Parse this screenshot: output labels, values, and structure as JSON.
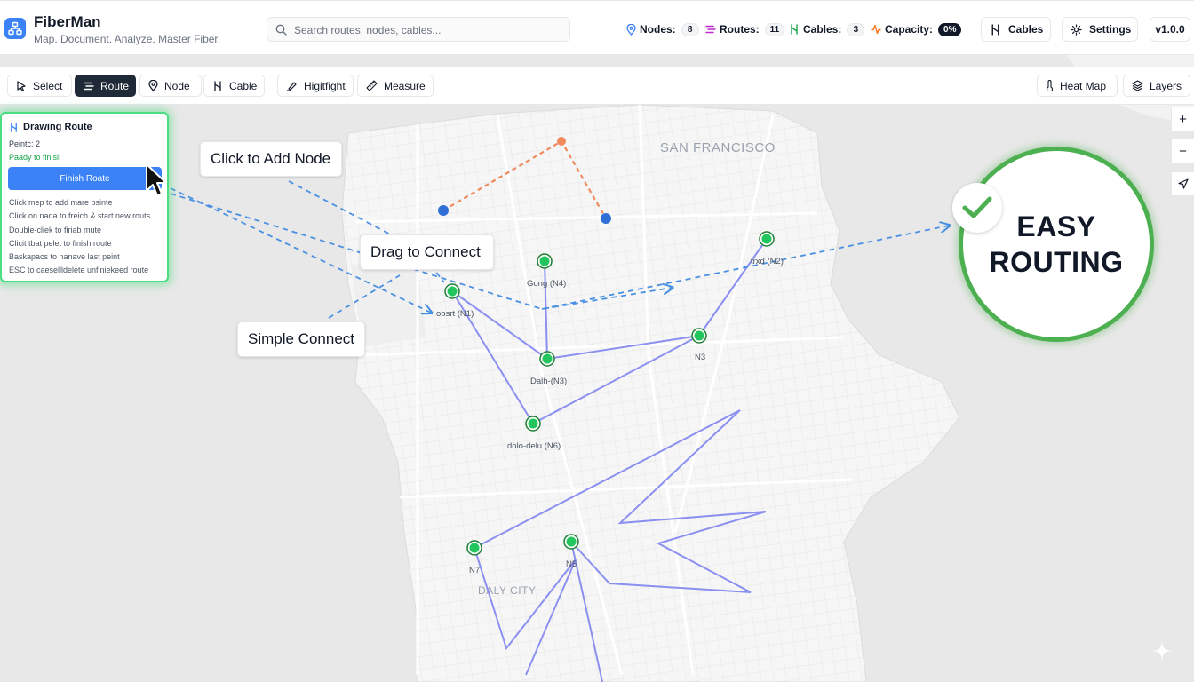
{
  "app": {
    "name": "FiberMan",
    "tagline": "Map. Document. Analyze. Master Fiber."
  },
  "search": {
    "placeholder": "Search routes, nodes, cables..."
  },
  "stats": {
    "nodes": {
      "label": "Nodes:",
      "value": "8"
    },
    "routes": {
      "label": "Routes:",
      "value": "11"
    },
    "cables": {
      "label": "Cables:",
      "value": "3"
    },
    "capacity": {
      "label": "Capacity:",
      "value": "0%"
    }
  },
  "header_buttons": {
    "cables": "Cables",
    "settings": "Settings",
    "version": "v1.0.0"
  },
  "toolbar": {
    "select": "Select",
    "route": "Route",
    "node": "Node",
    "cable": "Cable",
    "highlight": "Higitfight",
    "measure": "Measure",
    "heatmap": "Heat Map",
    "layers": "Layers"
  },
  "panel": {
    "title": "Drawing Route",
    "points": "Peintc: 2",
    "status": "Paady to finisi!",
    "finish_button": "Finish Roate",
    "instructions": [
      "Click mep to add mare psinte",
      "Click on nada to freich & start new routs",
      "Double-cliek to firiab mute",
      "Clicit tbat pelet to finish route",
      "Baskapacs to nanave last peint",
      "ESC to caesellldelete unfiniekeed route"
    ]
  },
  "callouts": {
    "add_node": "Click to Add Node",
    "drag": "Drag to Connect",
    "simple": "Simple Connect"
  },
  "badge": {
    "line1": "EASY",
    "line2": "ROUTING"
  },
  "map_controls": {
    "zoom_in": "+",
    "zoom_out": "−"
  },
  "map_labels": {
    "city1": "SAN FRANCISCO",
    "city2": "DALY CITY",
    "nodes": {
      "n1": "obsrt (N1)",
      "gong": "Gong (N4)",
      "dalh": "Dalh-(N3)",
      "dolo": "dolo-delu (N6)",
      "n3": "N3",
      "n2": "trxd (N2)",
      "n7": "N7",
      "n5": "N5"
    }
  },
  "colors": {
    "accent": "#3b82f6",
    "node": "#22c55e",
    "route": "#8b8ff0",
    "draft": "#f08a5d",
    "success": "#4caf50"
  }
}
